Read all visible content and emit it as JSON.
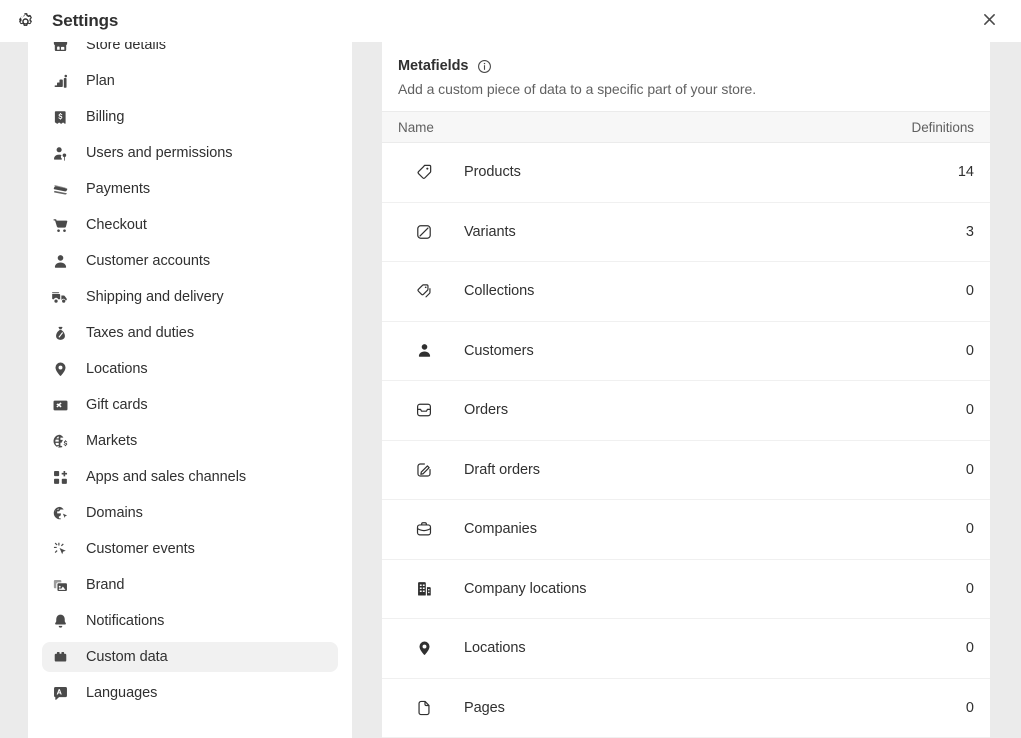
{
  "window": {
    "title": "Settings",
    "gear_icon": "gear-icon",
    "close_icon": "close-icon"
  },
  "sidebar": {
    "items": [
      {
        "label": "Store details",
        "icon": "store-icon",
        "selected": false
      },
      {
        "label": "Plan",
        "icon": "plan-chart-icon",
        "selected": false
      },
      {
        "label": "Billing",
        "icon": "billing-receipt-icon",
        "selected": false
      },
      {
        "label": "Users and permissions",
        "icon": "user-key-icon",
        "selected": false
      },
      {
        "label": "Payments",
        "icon": "payments-card-icon",
        "selected": false
      },
      {
        "label": "Checkout",
        "icon": "cart-icon",
        "selected": false
      },
      {
        "label": "Customer accounts",
        "icon": "person-icon",
        "selected": false
      },
      {
        "label": "Shipping and delivery",
        "icon": "delivery-truck-icon",
        "selected": false
      },
      {
        "label": "Taxes and duties",
        "icon": "tax-bag-icon",
        "selected": false
      },
      {
        "label": "Locations",
        "icon": "location-pin-icon",
        "selected": false
      },
      {
        "label": "Gift cards",
        "icon": "gift-card-icon",
        "selected": false
      },
      {
        "label": "Markets",
        "icon": "markets-globe-icon",
        "selected": false
      },
      {
        "label": "Apps and sales channels",
        "icon": "apps-grid-plus-icon",
        "selected": false
      },
      {
        "label": "Domains",
        "icon": "domains-globe-icon",
        "selected": false
      },
      {
        "label": "Customer events",
        "icon": "cursor-click-icon",
        "selected": false
      },
      {
        "label": "Brand",
        "icon": "brand-image-icon",
        "selected": false
      },
      {
        "label": "Notifications",
        "icon": "bell-icon",
        "selected": false
      },
      {
        "label": "Custom data",
        "icon": "custom-data-icon",
        "selected": true
      },
      {
        "label": "Languages",
        "icon": "languages-icon",
        "selected": false
      }
    ]
  },
  "main": {
    "card": {
      "title": "Metafields",
      "info_icon": "info-circle-icon",
      "subtitle": "Add a custom piece of data to a specific part of your store."
    },
    "table": {
      "columns": [
        "Name",
        "Definitions"
      ],
      "rows": [
        {
          "name": "Products",
          "icon": "tag-icon",
          "definitions": "14"
        },
        {
          "name": "Variants",
          "icon": "variant-tag-icon",
          "definitions": "3"
        },
        {
          "name": "Collections",
          "icon": "collections-tag-icon",
          "definitions": "0"
        },
        {
          "name": "Customers",
          "icon": "person-icon",
          "definitions": "0"
        },
        {
          "name": "Orders",
          "icon": "order-inbox-icon",
          "definitions": "0"
        },
        {
          "name": "Draft orders",
          "icon": "draft-order-edit-icon",
          "definitions": "0"
        },
        {
          "name": "Companies",
          "icon": "briefcase-icon",
          "definitions": "0"
        },
        {
          "name": "Company locations",
          "icon": "building-icon",
          "definitions": "0"
        },
        {
          "name": "Locations",
          "icon": "location-pin-icon",
          "definitions": "0"
        },
        {
          "name": "Pages",
          "icon": "page-document-icon",
          "definitions": "0"
        }
      ]
    }
  },
  "colors": {
    "surface": "#ffffff",
    "backdrop": "#ebebeb",
    "text": "#303030",
    "text_subdued": "#616161",
    "selected_bg": "#f1f1f1",
    "table_header_bg": "#f7f7f7",
    "divider": "#ebebeb"
  }
}
